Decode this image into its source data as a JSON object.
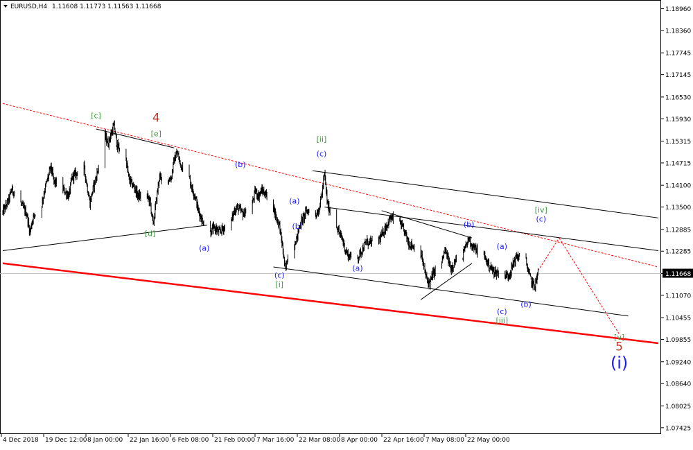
{
  "header": {
    "symbol": "EURUSD,H4",
    "ohlc": "1.11608 1.11773 1.11563 1.11668",
    "arrow_icon": "triangle-down-icon"
  },
  "current_price": "1.11668",
  "colors": {
    "background": "#ffffff",
    "border": "#000000",
    "candles": "#000000",
    "channel_lines": "#000000",
    "main_trendline": "#ff0000",
    "projection": "#ff0000",
    "price_line": "#c0c0c0",
    "price_box": "#000000",
    "wave_blue": "#1a1aff",
    "wave_green": "#3d9b3d",
    "wave_red": "#c0392b"
  },
  "chart_data": {
    "type": "candlestick",
    "y_axis_labels": [
      "1.18960",
      "1.18360",
      "1.17745",
      "1.17145",
      "1.16530",
      "1.15930",
      "1.15315",
      "1.14715",
      "1.14100",
      "1.13500",
      "1.12885",
      "1.12285",
      "1.11668",
      "1.11070",
      "1.10455",
      "1.09855",
      "1.09240",
      "1.08640",
      "1.08025",
      "1.07425"
    ],
    "x_axis_labels": [
      "4 Dec 2018",
      "19 Dec 12:00",
      "8 Jan 00:00",
      "22 Jan 16:00",
      "6 Feb 08:00",
      "21 Feb 00:00",
      "7 Mar 16:00",
      "22 Mar 08:00",
      "8 Apr 00:00",
      "22 Apr 16:00",
      "7 May 08:00",
      "22 May 00:00"
    ],
    "ylim": [
      1.0725,
      1.192
    ],
    "wave_labels": [
      {
        "text": "[c]",
        "color": "green",
        "date": "2019-01-04",
        "price": 1.1595
      },
      {
        "text": "4",
        "color": "red",
        "date": "2019-01-24",
        "price": 1.1585
      },
      {
        "text": "[e]",
        "color": "green",
        "date": "2019-01-24",
        "price": 1.1545
      },
      {
        "text": "[d]",
        "color": "green",
        "date": "2019-01-22",
        "price": 1.127
      },
      {
        "text": "(a)",
        "color": "blue",
        "date": "2019-02-09",
        "price": 1.123
      },
      {
        "text": "(b)",
        "color": "blue",
        "date": "2019-02-21",
        "price": 1.146
      },
      {
        "text": "(c)",
        "color": "blue",
        "date": "2019-03-06",
        "price": 1.1155
      },
      {
        "text": "[i]",
        "color": "green",
        "date": "2019-03-06",
        "price": 1.113
      },
      {
        "text": "(a)",
        "color": "blue",
        "date": "2019-03-11",
        "price": 1.136
      },
      {
        "text": "(b)",
        "color": "blue",
        "date": "2019-03-12",
        "price": 1.129
      },
      {
        "text": "[ii]",
        "color": "green",
        "date": "2019-03-20",
        "price": 1.153
      },
      {
        "text": "(c)",
        "color": "blue",
        "date": "2019-03-20",
        "price": 1.149
      },
      {
        "text": "(a)",
        "color": "blue",
        "date": "2019-04-01",
        "price": 1.1175
      },
      {
        "text": "(b)",
        "color": "blue",
        "date": "2019-05-08",
        "price": 1.1295
      },
      {
        "text": "(a)",
        "color": "blue",
        "date": "2019-05-19",
        "price": 1.1235
      },
      {
        "text": "(c)",
        "color": "blue",
        "date": "2019-05-19",
        "price": 1.1055
      },
      {
        "text": "[iii]",
        "color": "green",
        "date": "2019-05-19",
        "price": 1.103
      },
      {
        "text": "(b)",
        "color": "blue",
        "date": "2019-05-27",
        "price": 1.1075
      },
      {
        "text": "[iv]",
        "color": "green",
        "date": "2019-06-01",
        "price": 1.1335
      },
      {
        "text": "(c)",
        "color": "blue",
        "date": "2019-06-01",
        "price": 1.131
      },
      {
        "text": "[v]",
        "color": "green",
        "date": "2019-06-27",
        "price": 1.0985
      },
      {
        "text": "5",
        "color": "red",
        "date": "2019-06-27",
        "price": 1.0955
      },
      {
        "text": "(i)",
        "color": "blue",
        "date": "2019-06-27",
        "price": 1.0905
      }
    ],
    "price_path": [
      [
        "2018-12-04",
        1.1335
      ],
      [
        "2018-12-06",
        1.137
      ],
      [
        "2018-12-07",
        1.14
      ],
      [
        "2018-12-10",
        1.136
      ],
      [
        "2018-12-12",
        1.133
      ],
      [
        "2018-12-13",
        1.128
      ],
      [
        "2018-12-14",
        1.132
      ],
      [
        "2018-12-17",
        1.136
      ],
      [
        "2018-12-18",
        1.14
      ],
      [
        "2018-12-20",
        1.146
      ],
      [
        "2018-12-21",
        1.142
      ],
      [
        "2018-12-24",
        1.14
      ],
      [
        "2018-12-26",
        1.138
      ],
      [
        "2018-12-27",
        1.143
      ],
      [
        "2018-12-28",
        1.144
      ],
      [
        "2018-12-31",
        1.146
      ],
      [
        "2019-01-02",
        1.136
      ],
      [
        "2019-01-03",
        1.14
      ],
      [
        "2019-01-04",
        1.143
      ],
      [
        "2019-01-07",
        1.1545
      ],
      [
        "2019-01-08",
        1.1525
      ],
      [
        "2019-01-10",
        1.1575
      ],
      [
        "2019-01-11",
        1.152
      ],
      [
        "2019-01-14",
        1.148
      ],
      [
        "2019-01-15",
        1.1425
      ],
      [
        "2019-01-17",
        1.14
      ],
      [
        "2019-01-18",
        1.138
      ],
      [
        "2019-01-21",
        1.138
      ],
      [
        "2019-01-22",
        1.1365
      ],
      [
        "2019-01-23",
        1.13
      ],
      [
        "2019-01-24",
        1.1365
      ],
      [
        "2019-01-25",
        1.143
      ],
      [
        "2019-01-28",
        1.1425
      ],
      [
        "2019-01-29",
        1.143
      ],
      [
        "2019-01-30",
        1.148
      ],
      [
        "2019-01-31",
        1.15
      ],
      [
        "2019-02-01",
        1.147
      ],
      [
        "2019-02-04",
        1.143
      ],
      [
        "2019-02-05",
        1.14
      ],
      [
        "2019-02-06",
        1.138
      ],
      [
        "2019-02-07",
        1.134
      ],
      [
        "2019-02-08",
        1.132
      ],
      [
        "2019-02-11",
        1.128
      ],
      [
        "2019-02-12",
        1.129
      ],
      [
        "2019-02-13",
        1.129
      ],
      [
        "2019-02-14",
        1.128
      ],
      [
        "2019-02-15",
        1.129
      ],
      [
        "2019-02-18",
        1.131
      ],
      [
        "2019-02-19",
        1.134
      ],
      [
        "2019-02-20",
        1.135
      ],
      [
        "2019-02-21",
        1.134
      ],
      [
        "2019-02-22",
        1.133
      ],
      [
        "2019-02-25",
        1.136
      ],
      [
        "2019-02-26",
        1.1395
      ],
      [
        "2019-02-27",
        1.138
      ],
      [
        "2019-02-28",
        1.1395
      ],
      [
        "2019-03-01",
        1.139
      ],
      [
        "2019-03-04",
        1.135
      ],
      [
        "2019-03-05",
        1.132
      ],
      [
        "2019-03-06",
        1.13
      ],
      [
        "2019-03-07",
        1.124
      ],
      [
        "2019-03-08",
        1.1175
      ],
      [
        "2019-03-09",
        1.1225
      ],
      [
        "2019-03-11",
        1.125
      ],
      [
        "2019-03-12",
        1.127
      ],
      [
        "2019-03-13",
        1.131
      ],
      [
        "2019-03-14",
        1.132
      ],
      [
        "2019-03-15",
        1.134
      ],
      [
        "2019-03-18",
        1.133
      ],
      [
        "2019-03-19",
        1.134
      ],
      [
        "2019-03-20",
        1.138
      ],
      [
        "2019-03-21",
        1.144
      ],
      [
        "2019-03-22",
        1.1355
      ],
      [
        "2019-03-25",
        1.13
      ],
      [
        "2019-03-26",
        1.1275
      ],
      [
        "2019-03-27",
        1.126
      ],
      [
        "2019-03-28",
        1.123
      ],
      [
        "2019-03-29",
        1.1215
      ],
      [
        "2019-04-01",
        1.121
      ],
      [
        "2019-04-02",
        1.1225
      ],
      [
        "2019-04-03",
        1.124
      ],
      [
        "2019-04-04",
        1.1255
      ],
      [
        "2019-04-05",
        1.125
      ],
      [
        "2019-04-08",
        1.126
      ],
      [
        "2019-04-09",
        1.127
      ],
      [
        "2019-04-10",
        1.129
      ],
      [
        "2019-04-11",
        1.1305
      ],
      [
        "2019-04-12",
        1.132
      ],
      [
        "2019-04-15",
        1.131
      ],
      [
        "2019-04-16",
        1.129
      ],
      [
        "2019-04-17",
        1.1275
      ],
      [
        "2019-04-18",
        1.125
      ],
      [
        "2019-04-19",
        1.1245
      ],
      [
        "2019-04-22",
        1.1225
      ],
      [
        "2019-04-23",
        1.1185
      ],
      [
        "2019-04-24",
        1.115
      ],
      [
        "2019-04-25",
        1.114
      ],
      [
        "2019-04-26",
        1.1165
      ],
      [
        "2019-04-29",
        1.12
      ],
      [
        "2019-04-30",
        1.123
      ],
      [
        "2019-05-01",
        1.121
      ],
      [
        "2019-05-02",
        1.118
      ],
      [
        "2019-05-03",
        1.1195
      ],
      [
        "2019-05-06",
        1.122
      ],
      [
        "2019-05-07",
        1.124
      ],
      [
        "2019-05-08",
        1.1265
      ],
      [
        "2019-05-09",
        1.1245
      ],
      [
        "2019-05-10",
        1.1235
      ],
      [
        "2019-05-13",
        1.1215
      ],
      [
        "2019-05-14",
        1.12
      ],
      [
        "2019-05-15",
        1.1185
      ],
      [
        "2019-05-16",
        1.1175
      ],
      [
        "2019-05-17",
        1.117
      ],
      [
        "2019-05-20",
        1.1165
      ],
      [
        "2019-05-21",
        1.116
      ],
      [
        "2019-05-22",
        1.1175
      ],
      [
        "2019-05-23",
        1.12
      ],
      [
        "2019-05-24",
        1.1215
      ],
      [
        "2019-05-27",
        1.12
      ],
      [
        "2019-05-28",
        1.1165
      ],
      [
        "2019-05-29",
        1.114
      ],
      [
        "2019-05-30",
        1.1135
      ],
      [
        "2019-05-31",
        1.1167
      ]
    ],
    "trendlines": [
      {
        "style": "red-thick",
        "from": [
          "2018-12-04",
          1.1195
        ],
        "to": [
          "2019-07-10",
          1.0975
        ]
      },
      {
        "style": "red-dashed",
        "from": [
          "2018-12-04",
          1.1635
        ],
        "to": [
          "2019-07-10",
          1.1185
        ]
      },
      {
        "style": "black",
        "from": [
          "2019-01-04",
          1.1565
        ],
        "to": [
          "2019-01-30",
          1.1513
        ]
      },
      {
        "style": "black",
        "from": [
          "2018-12-04",
          1.123
        ],
        "to": [
          "2019-02-10",
          1.13
        ]
      },
      {
        "style": "black",
        "from": [
          "2019-03-17",
          1.145
        ],
        "to": [
          "2019-07-10",
          1.132
        ]
      },
      {
        "style": "black",
        "from": [
          "2019-03-21",
          1.135
        ],
        "to": [
          "2019-07-10",
          1.123
        ]
      },
      {
        "style": "black",
        "from": [
          "2019-03-04",
          1.1185
        ],
        "to": [
          "2019-06-30",
          1.105
        ]
      },
      {
        "style": "black",
        "from": [
          "2019-04-09",
          1.134
        ],
        "to": [
          "2019-05-09",
          1.1265
        ]
      },
      {
        "style": "black",
        "from": [
          "2019-04-22",
          1.1095
        ],
        "to": [
          "2019-05-09",
          1.1195
        ]
      },
      {
        "style": "red-dotted",
        "from": [
          "2019-05-31",
          1.1175
        ],
        "to": [
          "2019-06-07",
          1.1265
        ]
      },
      {
        "style": "red-dotted",
        "from": [
          "2019-06-07",
          1.1265
        ],
        "to": [
          "2019-06-27",
          1.1
        ]
      }
    ]
  }
}
